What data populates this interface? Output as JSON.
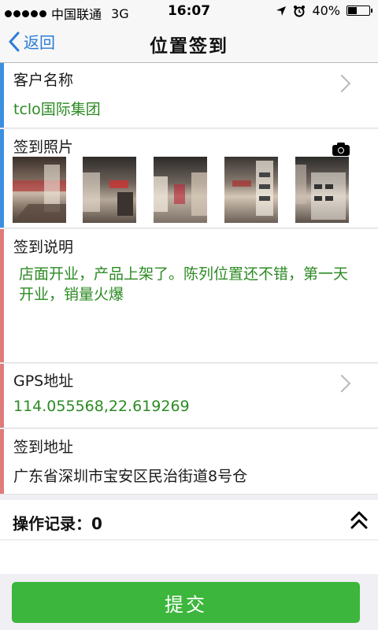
{
  "status_bar": {
    "carrier": "中国联通",
    "network": "3G",
    "time": "16:07",
    "battery": "40%",
    "battery_level": 0.4
  },
  "nav": {
    "back_label": "返回",
    "title": "位置签到"
  },
  "customer": {
    "label": "客户名称",
    "value": "tclo国际集团"
  },
  "photos": {
    "label": "签到照片",
    "items": [
      "photo-1",
      "photo-2",
      "photo-3",
      "photo-4",
      "photo-5"
    ]
  },
  "description": {
    "label": "签到说明",
    "value": "店面开业，产品上架了。陈列位置还不错，第一天开业，销量火爆"
  },
  "gps": {
    "label": "GPS地址",
    "value": "114.055568,22.619269"
  },
  "address": {
    "label": "签到地址",
    "value": "广东省深圳市宝安区民治街道8号仓"
  },
  "record": {
    "title": "操作记录：0"
  },
  "submit_label": "提交",
  "colors": {
    "accent_blue": "#2a7cd8",
    "value_green": "#2c8a23",
    "stripe_blue": "#3b8fe0",
    "stripe_red": "#e07b7b",
    "submit_green": "#3cb63c"
  },
  "icons": [
    "signal-dots-icon",
    "location-arrow-icon",
    "alarm-icon",
    "battery-icon",
    "back-chevron-icon",
    "chevron-right-icon",
    "camera-icon",
    "double-chevron-up-icon"
  ]
}
